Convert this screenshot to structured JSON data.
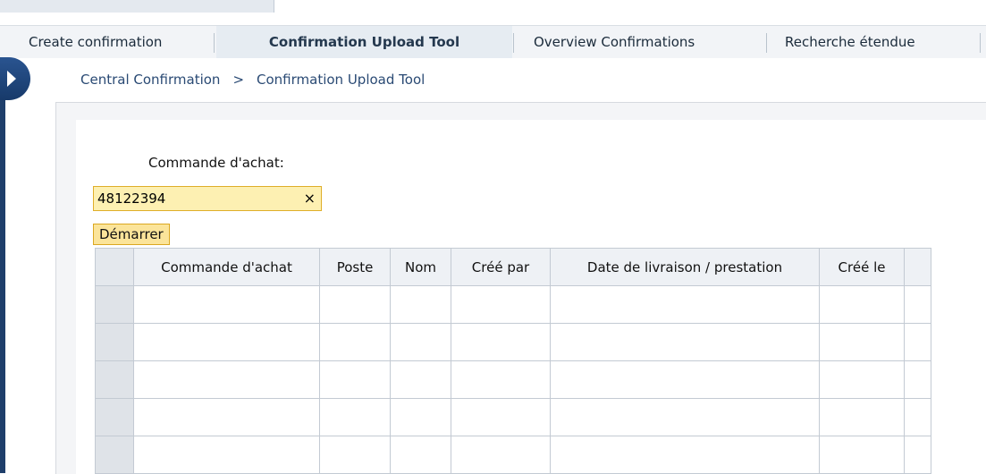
{
  "tabs": [
    {
      "label": "Create confirmation",
      "active": false
    },
    {
      "label": "Confirmation Upload Tool",
      "active": true
    },
    {
      "label": "Overview Confirmations",
      "active": false
    },
    {
      "label": "Recherche étendue",
      "active": false
    }
  ],
  "breadcrumb": {
    "items": [
      "Central Confirmation",
      "Confirmation Upload Tool"
    ],
    "separator": ">"
  },
  "form": {
    "label": "Commande d'achat:",
    "value": "48122394",
    "clear_icon": "×",
    "start_button": "Démarrer"
  },
  "table": {
    "columns": [
      "Commande d'achat",
      "Poste",
      "Nom",
      "Créé par",
      "Date de livraison / prestation",
      "Créé le"
    ],
    "row_count": 5
  },
  "icons": {
    "sidebar_toggle": "chevron-right-icon",
    "clear": "close-icon"
  },
  "colors": {
    "accent": "#24384e",
    "input_bg": "#fdf0b2",
    "button_bg": "#fbe49a",
    "sidebar": "#1f3f6b"
  }
}
